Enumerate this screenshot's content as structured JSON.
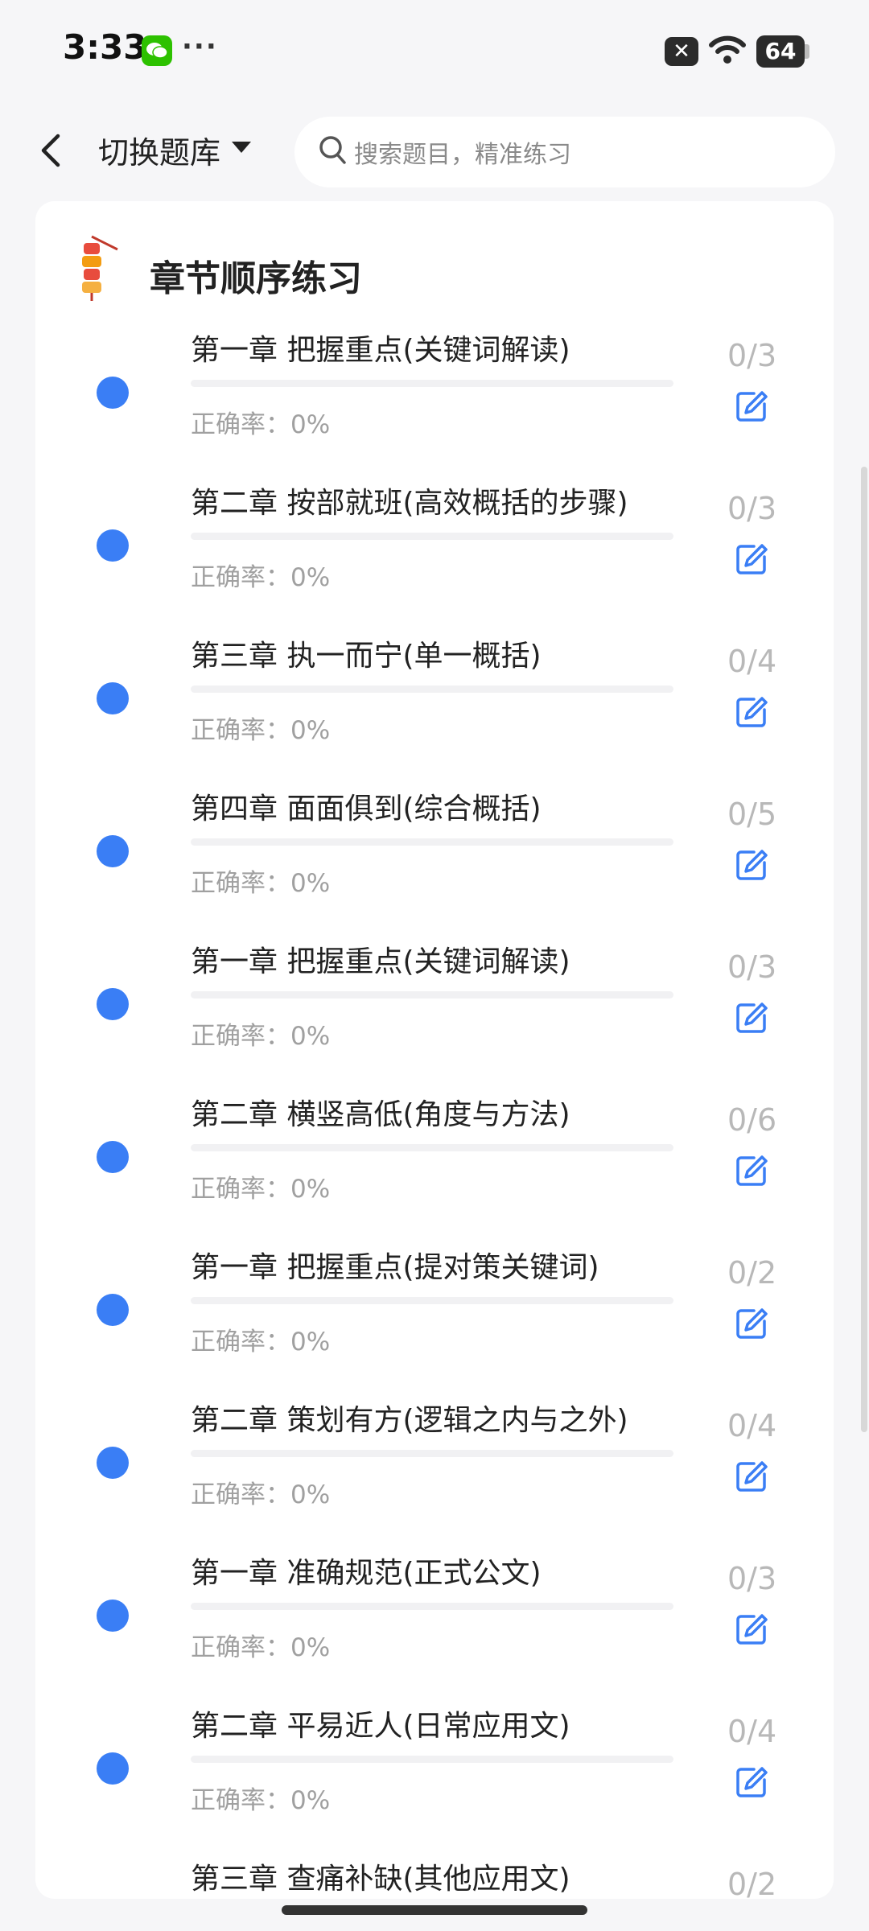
{
  "status": {
    "time": "3:33",
    "more": "···",
    "battery": "64"
  },
  "nav": {
    "switch_bank": "切换题库",
    "search_placeholder": "搜索题目，精准练习"
  },
  "section_title": "章节顺序练习",
  "chapters": [
    {
      "title": "第一章 把握重点(关键词解读)",
      "accuracy": "正确率：0%",
      "count": "0/3",
      "progress": 0
    },
    {
      "title": "第二章 按部就班(高效概括的步骤)",
      "accuracy": "正确率：0%",
      "count": "0/3",
      "progress": 0
    },
    {
      "title": "第三章 执一而宁(单一概括)",
      "accuracy": "正确率：0%",
      "count": "0/4",
      "progress": 0
    },
    {
      "title": "第四章 面面俱到(综合概括)",
      "accuracy": "正确率：0%",
      "count": "0/5",
      "progress": 0
    },
    {
      "title": "第一章 把握重点(关键词解读)",
      "accuracy": "正确率：0%",
      "count": "0/3",
      "progress": 0
    },
    {
      "title": "第二章 横竖高低(角度与方法)",
      "accuracy": "正确率：0%",
      "count": "0/6",
      "progress": 0
    },
    {
      "title": "第一章 把握重点(提对策关键词)",
      "accuracy": "正确率：0%",
      "count": "0/2",
      "progress": 0
    },
    {
      "title": "第二章 策划有方(逻辑之内与之外)",
      "accuracy": "正确率：0%",
      "count": "0/4",
      "progress": 0
    },
    {
      "title": "第一章 准确规范(正式公文)",
      "accuracy": "正确率：0%",
      "count": "0/3",
      "progress": 0
    },
    {
      "title": "第二章 平易近人(日常应用文)",
      "accuracy": "正确率：0%",
      "count": "0/4",
      "progress": 0
    },
    {
      "title": "第三章 查痛补缺(其他应用文)",
      "accuracy": "",
      "count": "0/2",
      "progress": 0
    }
  ],
  "colors": {
    "accent": "#3a7ef5",
    "wechat": "#2dc100"
  }
}
